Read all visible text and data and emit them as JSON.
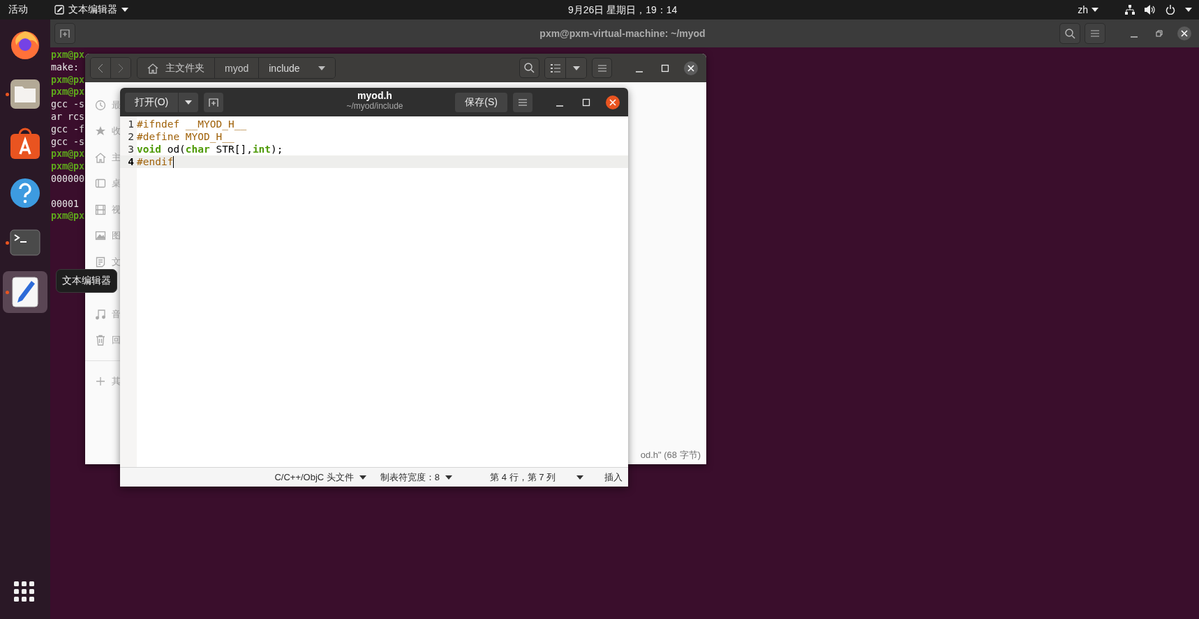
{
  "top_bar": {
    "activities": "活动",
    "app_menu": "文本编辑器",
    "clock": "9月26日 星期日，19：14",
    "input_method": "zh"
  },
  "dock": {
    "items": [
      {
        "kind": "firefox",
        "running": false,
        "selected": false
      },
      {
        "kind": "files",
        "running": true,
        "selected": false
      },
      {
        "kind": "software",
        "running": false,
        "selected": false
      },
      {
        "kind": "help",
        "running": false,
        "selected": false
      },
      {
        "kind": "terminal",
        "running": true,
        "selected": false
      },
      {
        "kind": "editor",
        "running": true,
        "selected": true
      }
    ],
    "tooltip": "文本编辑器"
  },
  "terminal": {
    "title": "pxm@pxm-virtual-machine: ~/myod",
    "lines": [
      {
        "text": "pxm@px",
        "kind": "prompt"
      },
      {
        "text": "make:",
        "kind": "output"
      },
      {
        "text": "pxm@px",
        "kind": "prompt"
      },
      {
        "text": "pxm@px",
        "kind": "prompt"
      },
      {
        "text": "gcc -s",
        "kind": "output"
      },
      {
        "text": "ar rcs",
        "kind": "output"
      },
      {
        "text": "gcc -f",
        "kind": "output"
      },
      {
        "text": "gcc -s",
        "kind": "output"
      },
      {
        "text": "pxm@px",
        "kind": "prompt"
      },
      {
        "text": "pxm@px",
        "kind": "prompt"
      },
      {
        "text": "000000",
        "kind": "output"
      },
      {
        "kind": "blank"
      },
      {
        "text": "00001",
        "kind": "output"
      },
      {
        "text": "pxm@px",
        "kind": "prompt"
      }
    ]
  },
  "file_manager": {
    "path": [
      {
        "label": "主文件夹",
        "kind": "home"
      },
      {
        "label": "myod",
        "kind": "folder"
      },
      {
        "label": "include",
        "kind": "current"
      }
    ],
    "sidebar": [
      {
        "label": "最",
        "kind": "recent"
      },
      {
        "label": "收",
        "kind": "starred"
      },
      {
        "label": "主",
        "kind": "home"
      },
      {
        "label": "桌",
        "kind": "desktop"
      },
      {
        "label": "视",
        "kind": "videos"
      },
      {
        "label": "图",
        "kind": "pictures"
      },
      {
        "label": "文",
        "kind": "documents"
      },
      {
        "kind": "covered"
      },
      {
        "label": "音",
        "kind": "music"
      },
      {
        "label": "回",
        "kind": "trash"
      },
      {
        "label": "其",
        "kind": "other"
      }
    ],
    "status": "od.h\" (68 字节)"
  },
  "editor": {
    "open_button": "打开(O)",
    "title": "myod.h",
    "subtitle": "~/myod/include",
    "save_button": "保存(S)",
    "lines": [
      {
        "number": "1",
        "current": false,
        "tokens": [
          {
            "text": "#ifndef __MYOD_H__",
            "kind": "preprocessor"
          }
        ]
      },
      {
        "number": "2",
        "current": false,
        "tokens": [
          {
            "text": "#define MYOD_H__",
            "kind": "preprocessor"
          }
        ]
      },
      {
        "number": "3",
        "current": false,
        "tokens": [
          {
            "text": "void",
            "kind": "keyword"
          },
          {
            "text": " od(",
            "kind": "plain"
          },
          {
            "text": "char",
            "kind": "keyword"
          },
          {
            "text": " STR[],",
            "kind": "plain"
          },
          {
            "text": "int",
            "kind": "keyword"
          },
          {
            "text": ");",
            "kind": "plain"
          }
        ]
      },
      {
        "number": "4",
        "current": true,
        "tokens": [
          {
            "text": "#endif",
            "kind": "preprocessor"
          }
        ]
      }
    ],
    "status": {
      "language": "C/C++/ObjC 头文件",
      "tab_width": "制表符宽度：8",
      "position": "第 4 行，第 7 列",
      "mode": "插入"
    }
  }
}
